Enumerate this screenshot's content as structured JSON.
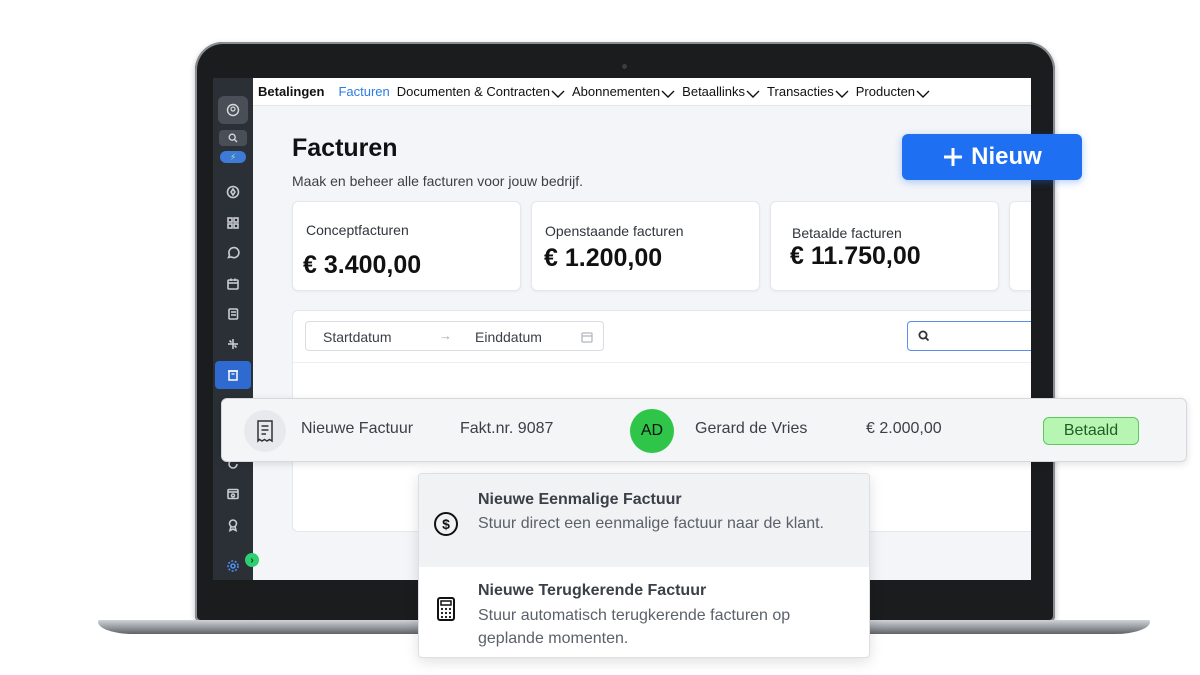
{
  "nav": {
    "brand": "Betalingen",
    "items": [
      {
        "label": "Facturen",
        "active": true,
        "dropdown": false
      },
      {
        "label": "Documenten & Contracten",
        "active": false,
        "dropdown": true
      },
      {
        "label": "Abonnementen",
        "active": false,
        "dropdown": true
      },
      {
        "label": "Betaallinks",
        "active": false,
        "dropdown": true
      },
      {
        "label": "Transacties",
        "active": false,
        "dropdown": true
      },
      {
        "label": "Producten",
        "active": false,
        "dropdown": true
      }
    ]
  },
  "page": {
    "title": "Facturen",
    "subtitle": "Maak en beheer alle facturen voor jouw bedrijf."
  },
  "new_button": {
    "label": "Nieuw"
  },
  "stats": [
    {
      "label": "Conceptfacturen",
      "value": "€ 3.400,00"
    },
    {
      "label": "Openstaande facturen",
      "value": "€ 1.200,00"
    },
    {
      "label": "Betaalde facturen",
      "value": "€ 11.750,00"
    }
  ],
  "filters": {
    "start_placeholder": "Startdatum",
    "arrow": "→",
    "end_placeholder": "Einddatum"
  },
  "invoice_row": {
    "title": "Nieuwe Factuur",
    "number": "Fakt.nr. 9087",
    "avatar_initials": "AD",
    "customer": "Gerard de Vries",
    "amount": "€ 2.000,00",
    "status": "Betaald"
  },
  "dropdown": {
    "items": [
      {
        "title": "Nieuwe Eenmalige Factuur",
        "description": "Stuur direct een eenmalige factuur naar de klant.",
        "icon": "dollar-circle-icon"
      },
      {
        "title": "Nieuwe Terugkerende Factuur",
        "description": "Stuur automatisch terugkerende facturen op geplande momenten.",
        "icon": "calculator-icon"
      }
    ]
  },
  "colors": {
    "accent": "#1f6ff2",
    "nav_active": "#2b7be4",
    "sidebar": "#2b2f36",
    "status_paid_bg": "#b7f5b2",
    "avatar": "#2fc548"
  }
}
